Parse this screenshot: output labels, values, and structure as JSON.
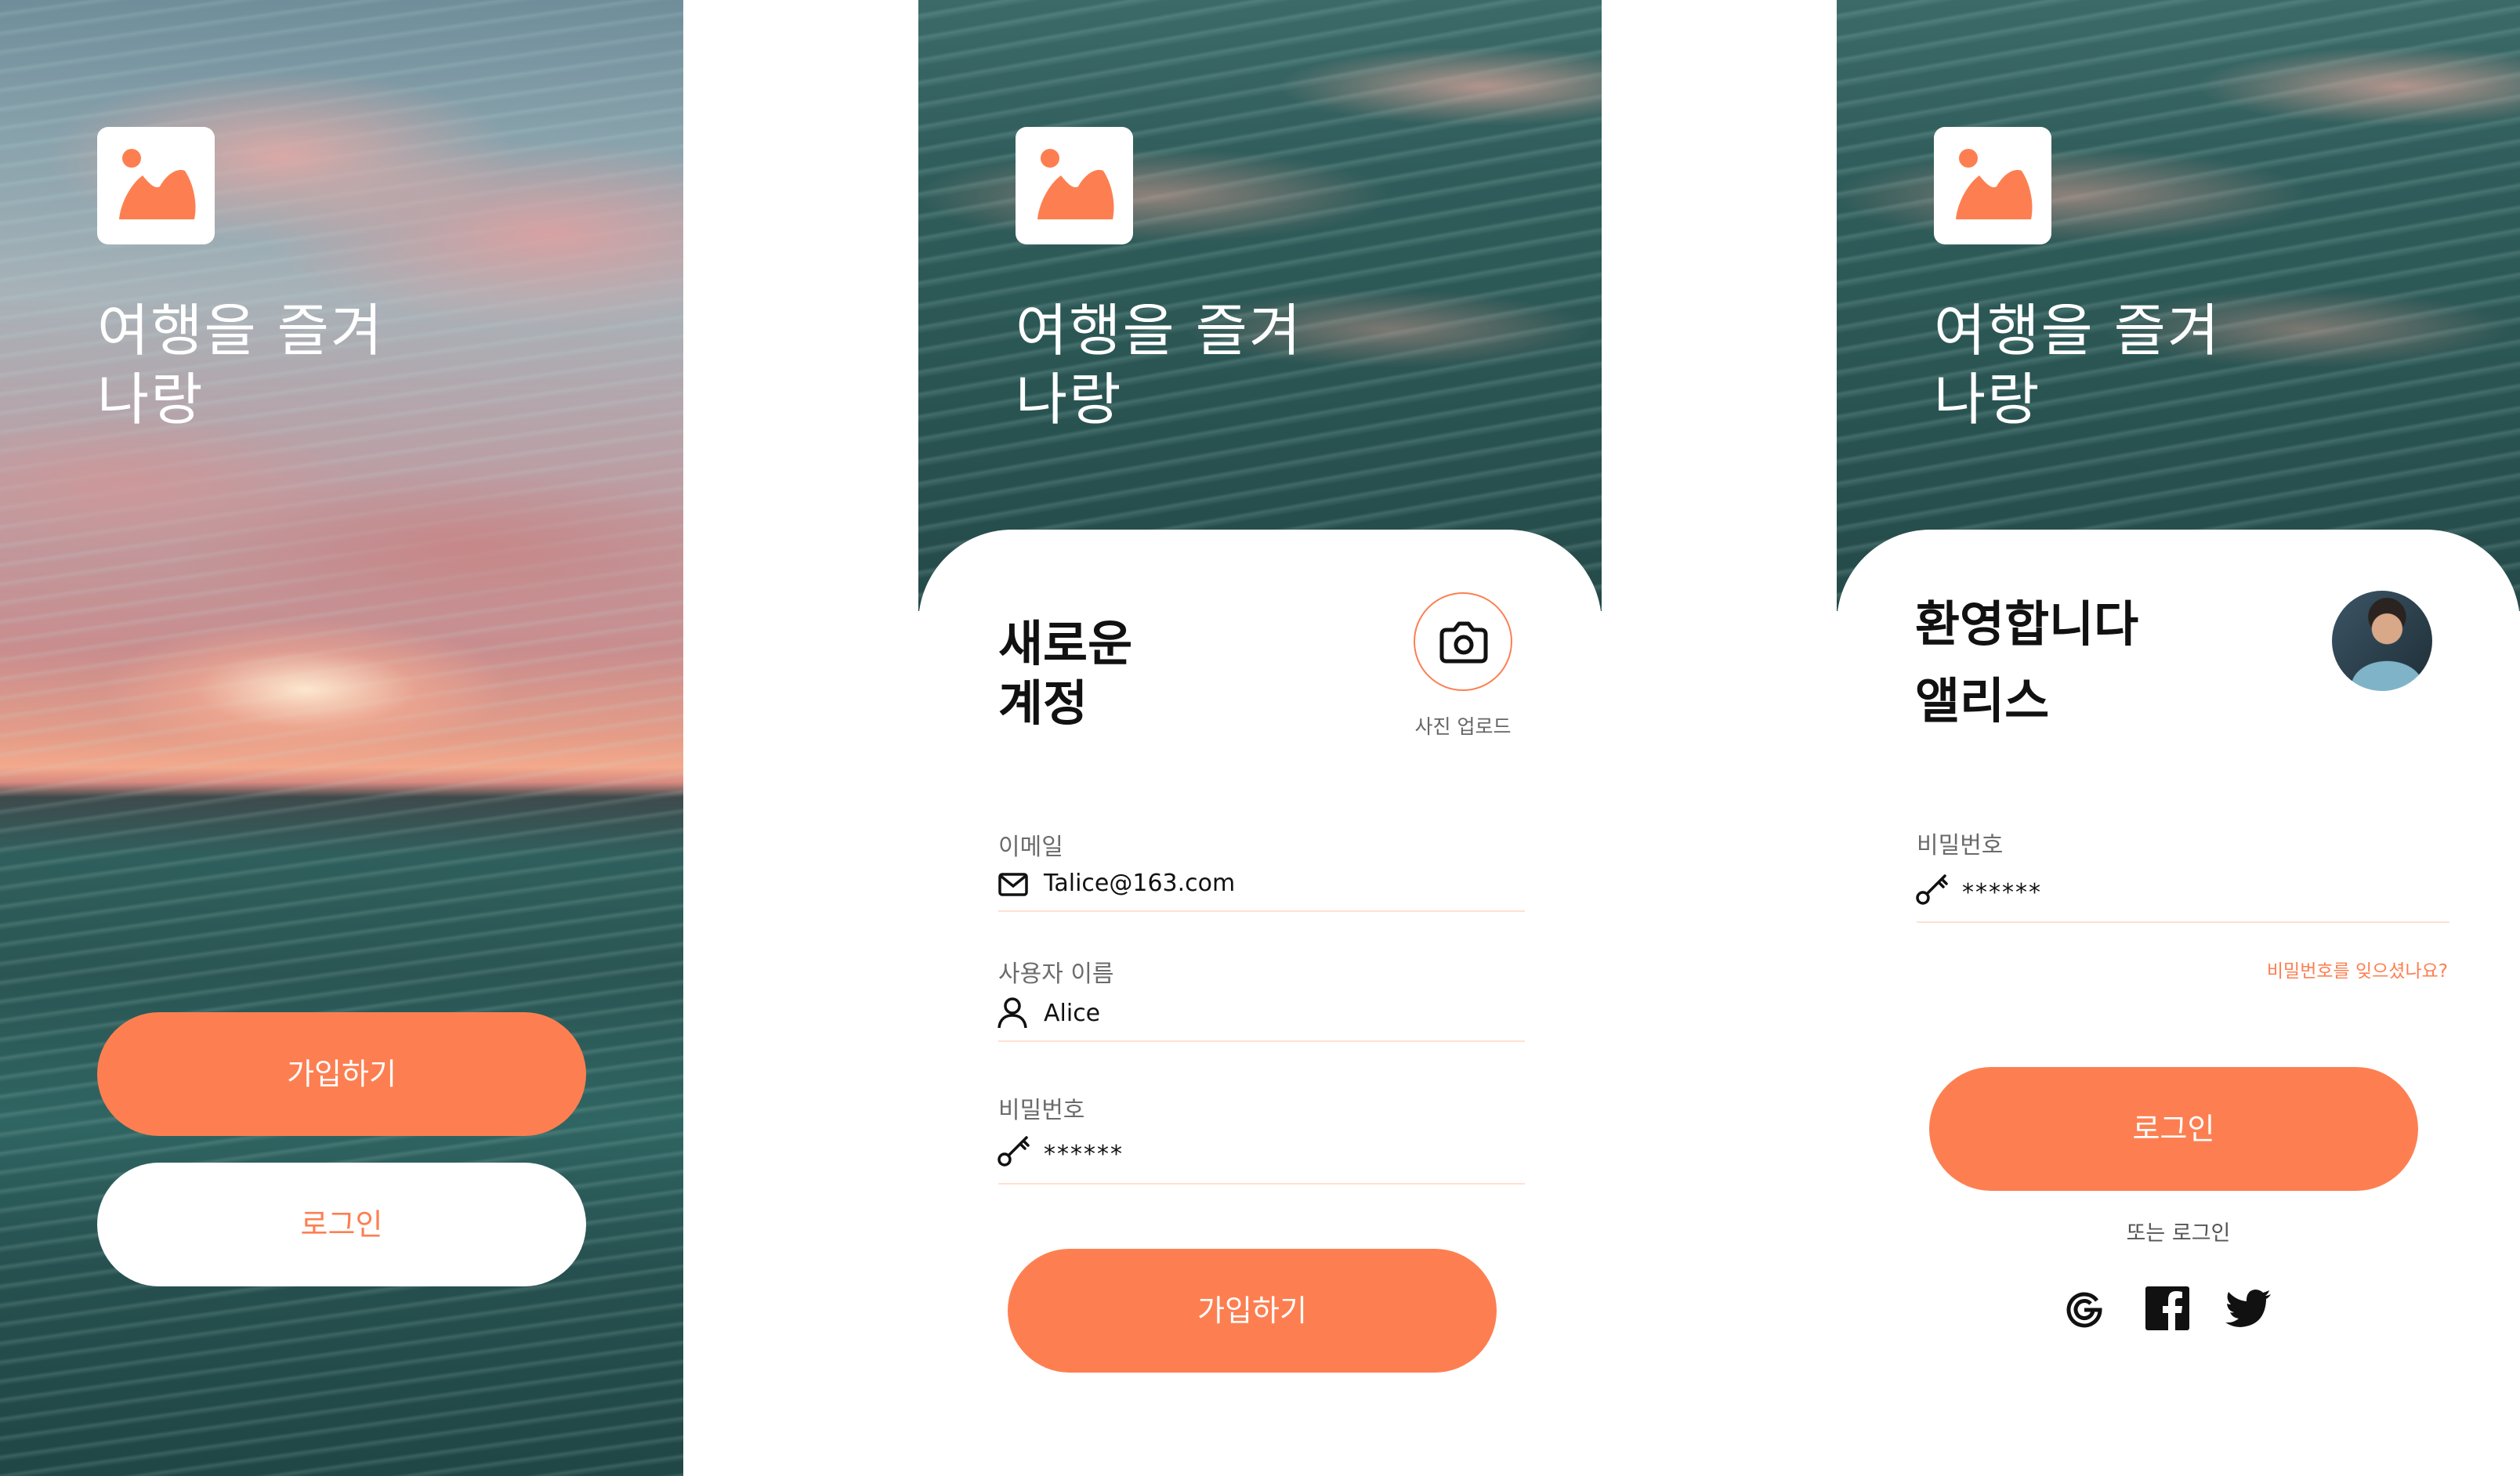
{
  "brand": {
    "accent": "#fd7f51",
    "tint": "#ffe0d3"
  },
  "hero": {
    "title": "여행을 즐겨\n나랑"
  },
  "screen1": {
    "signup_label": "가입하기",
    "login_label": "로그인"
  },
  "screen2": {
    "title": "새로운\n계정",
    "upload_caption": "사진 업로드",
    "email": {
      "label": "이메일",
      "value": "Talice@163.com",
      "icon": "mail-icon"
    },
    "username": {
      "label": "사용자 이름",
      "value": "Alice",
      "icon": "user-icon"
    },
    "password": {
      "label": "비밀번호",
      "value": "******",
      "icon": "key-icon"
    },
    "submit_label": "가입하기"
  },
  "screen3": {
    "title": "환영합니다\n앨리스",
    "password": {
      "label": "비밀번호",
      "value": "******",
      "icon": "key-icon"
    },
    "forgot_label": "비밀번호를 잊으셨나요?",
    "login_label": "로그인",
    "or_label": "또는 로그인",
    "socials": [
      "google-icon",
      "facebook-icon",
      "twitter-icon"
    ]
  }
}
